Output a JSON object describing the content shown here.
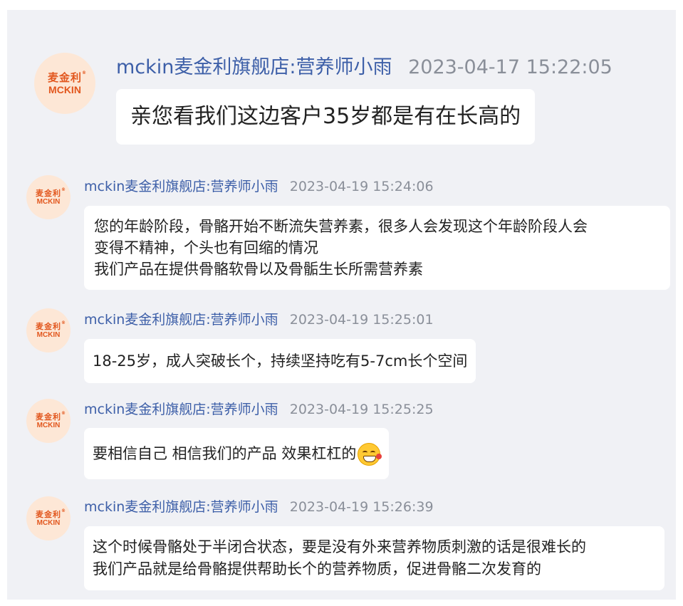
{
  "avatar_logo": {
    "cn": "麦金利",
    "reg": "®",
    "en": "MCKIN"
  },
  "messages": [
    {
      "sender": "mckin麦金利旗舰店:营养师小雨",
      "time": "2023-04-17 15:22:05",
      "lines": [
        "亲您看我们这边客户35岁都是有在长高的"
      ]
    },
    {
      "sender": "mckin麦金利旗舰店:营养师小雨",
      "time": "2023-04-19 15:24:06",
      "lines": [
        "您的年龄阶段，骨骼开始不断流失营养素，很多人会发现这个年龄阶段人会",
        "变得不精神，个头也有回缩的情况",
        "我们产品在提供骨骼软骨以及骨骺生长所需营养素"
      ]
    },
    {
      "sender": "mckin麦金利旗舰店:营养师小雨",
      "time": "2023-04-19 15:25:01",
      "lines": [
        "18-25岁，成人突破长个，持续坚持吃有5-7cm长个空间"
      ]
    },
    {
      "sender": "mckin麦金利旗舰店:营养师小雨",
      "time": "2023-04-19 15:25:25",
      "lines": [
        "要相信自己 相信我们的产品 效果杠杠的"
      ],
      "emoji": "grinning-face-emoji"
    },
    {
      "sender": "mckin麦金利旗舰店:营养师小雨",
      "time": "2023-04-19 15:26:39",
      "lines": [
        "这个时候骨骼处于半闭合状态，要是没有外来营养物质刺激的话是很难长的",
        "我们产品就是给骨骼提供帮助长个的营养物质，促进骨骼二次发育的"
      ]
    }
  ],
  "colors": {
    "background": "#f0f1f5",
    "bubble": "#ffffff",
    "sender": "#3d5fa8",
    "time": "#8a8f99",
    "logo": "#e2571e",
    "avatar_bg": "#fde7d6"
  }
}
